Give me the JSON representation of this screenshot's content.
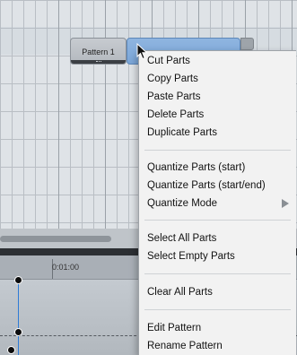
{
  "pattern_editor": {
    "part_1_label": "Pattern 1"
  },
  "timeline": {
    "ruler_time": "0:01:00"
  },
  "context_menu": {
    "items": [
      {
        "label": "Cut Parts"
      },
      {
        "label": "Copy Parts"
      },
      {
        "label": "Paste Parts"
      },
      {
        "label": "Delete Parts"
      },
      {
        "label": "Duplicate Parts"
      },
      {
        "label": "Quantize Parts (start)"
      },
      {
        "label": "Quantize Parts (start/end)"
      },
      {
        "label": "Quantize Mode",
        "has_submenu": true
      },
      {
        "label": "Select All Parts"
      },
      {
        "label": "Select Empty Parts"
      },
      {
        "label": "Clear All Parts"
      },
      {
        "label": "Edit Pattern"
      },
      {
        "label": "Rename Pattern"
      }
    ]
  },
  "icons": {
    "cursor": "arrow-pointer-icon",
    "submenu": "triangle-right-icon"
  },
  "colors": {
    "selected_part": "#7aa5d7",
    "menu_background": "#f2f2f2",
    "playhead": "#2e7bd6"
  }
}
